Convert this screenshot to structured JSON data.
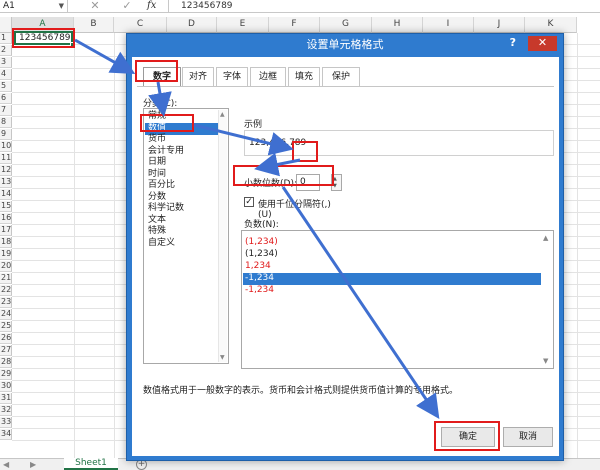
{
  "formula_bar": {
    "name_box": "A1",
    "cancel_icon": "✕",
    "enter_icon": "✓",
    "fx_label": "fx",
    "formula": "123456789"
  },
  "grid": {
    "columns": [
      "A",
      "B",
      "C",
      "D",
      "E",
      "F",
      "G",
      "H",
      "I",
      "J",
      "K"
    ],
    "rows": [
      "1",
      "2",
      "3",
      "4",
      "5",
      "6",
      "7",
      "8",
      "9",
      "10",
      "11",
      "12",
      "13",
      "14",
      "15",
      "16",
      "17",
      "18",
      "19",
      "20",
      "21",
      "22",
      "23",
      "24",
      "25",
      "26",
      "27",
      "28",
      "29",
      "30",
      "31",
      "32",
      "33",
      "34"
    ],
    "cell_a1": "123456789"
  },
  "sheet_tabs": {
    "active": "Sheet1",
    "add_icon": "+"
  },
  "dialog": {
    "title": "设置单元格格式",
    "help": "?",
    "close": "✕",
    "tabs": [
      "数字",
      "对齐",
      "字体",
      "边框",
      "填充",
      "保护"
    ],
    "active_tab": "数字",
    "category_label": "分类(C):",
    "categories": [
      "常规",
      "数值",
      "货币",
      "会计专用",
      "日期",
      "时间",
      "百分比",
      "分数",
      "科学记数",
      "文本",
      "特殊",
      "自定义"
    ],
    "selected_category": "数值",
    "sample_label": "示例",
    "sample_value": "123,456,789",
    "decimals_label": "小数位数(D):",
    "decimals_value": "0",
    "use_thousands_label": "使用千位分隔符(,)(U)",
    "use_thousands_checked": true,
    "negative_label": "负数(N):",
    "negative_options": [
      {
        "text": "(1,234)",
        "color": "#e11b1b",
        "selected": false
      },
      {
        "text": "(1,234)",
        "color": "#222222",
        "selected": false
      },
      {
        "text": "1,234",
        "color": "#e11b1b",
        "selected": false
      },
      {
        "text": "-1,234",
        "color": "#ffffff",
        "selected": true
      },
      {
        "text": "-1,234",
        "color": "#e11b1b",
        "selected": false
      }
    ],
    "description": "数值格式用于一般数字的表示。货币和会计格式则提供货币值计算的专用格式。",
    "ok_label": "确定",
    "cancel_label": "取消"
  },
  "colors": {
    "accent": "#2f7bcf",
    "excel_green": "#217346",
    "annotation_red": "#e11b1b",
    "annotation_arrow": "#3f6fd0"
  }
}
